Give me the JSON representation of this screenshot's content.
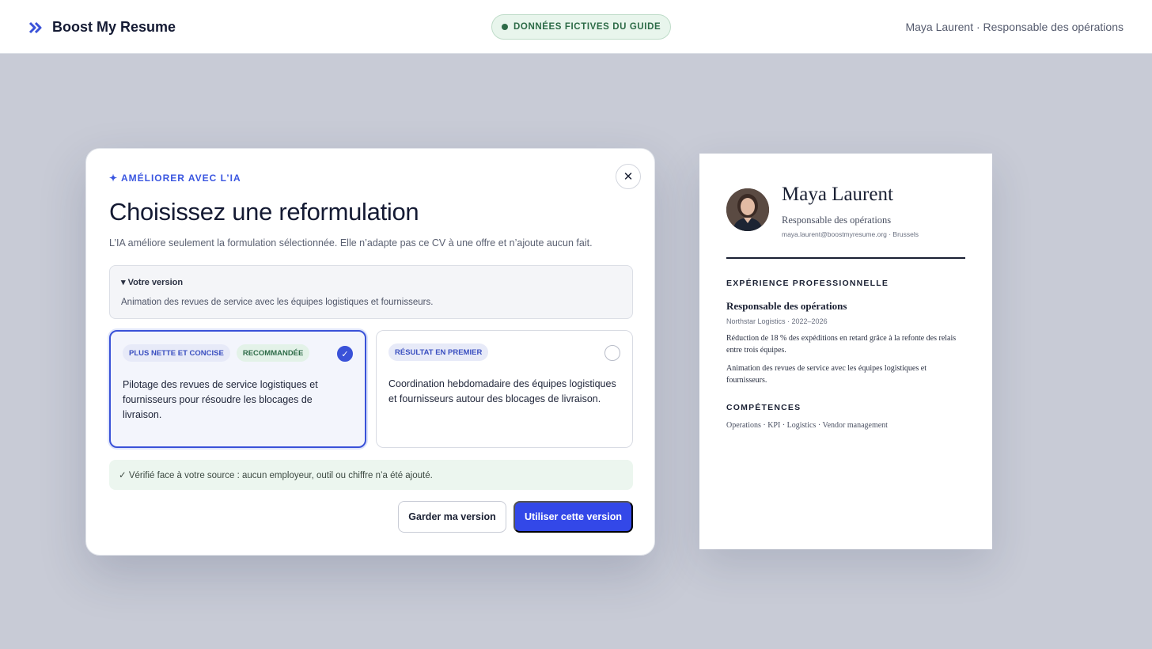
{
  "header": {
    "brand_name": "Boost My Resume",
    "brand_icon": "double-chevron-right-icon",
    "badge": "DONNÉES FICTIVES DU GUIDE",
    "user_line": "Maya Laurent · Responsable des opérations"
  },
  "modal": {
    "kicker": "✦ AMÉLIORER AVEC L’IA",
    "close_label": "✕",
    "title": "Choisissez une reformulation",
    "subtitle": "L’IA améliore seulement la formulation sélectionnée. Elle n’adapte pas ce CV à une offre et n’ajoute aucun fait.",
    "original": {
      "summary": "▾ Votre version",
      "text": "Animation des revues de service avec les équipes logistiques et fournisseurs."
    },
    "options": [
      {
        "tags": [
          "PLUS NETTE ET CONCISE",
          "RECOMMANDÉE"
        ],
        "text": "Pilotage des revues de service logistiques et fournisseurs pour résoudre les blocages de livraison.",
        "selected": true
      },
      {
        "tags": [
          "RÉSULTAT EN PREMIER"
        ],
        "text": "Coordination hebdomadaire des équipes logistiques et fournisseurs autour des blocages de livraison.",
        "selected": false
      }
    ],
    "verified": "✓ Vérifié face à votre source : aucun employeur, outil ou chiffre n’a été ajouté.",
    "buttons": {
      "keep": "Garder ma version",
      "use": "Utiliser cette version"
    }
  },
  "resume": {
    "name": "Maya Laurent",
    "role": "Responsable des opérations",
    "contact": "maya.laurent@boostmyresume.org · Brussels",
    "experience_heading": "EXPÉRIENCE PROFESSIONNELLE",
    "job_title": "Responsable des opérations",
    "job_meta": "Northstar Logistics · 2022–2026",
    "bullets": [
      "Réduction de 18 % des expéditions en retard grâce à la refonte des relais entre trois équipes.",
      "Animation des revues de service avec les équipes logistiques et fournisseurs."
    ],
    "skills_heading": "COMPÉTENCES",
    "skills": "Operations · KPI · Logistics · Vendor management"
  },
  "colors": {
    "accent": "#3348e8",
    "success_bg": "#ecf6ef",
    "success_text": "#2d6b47",
    "page_bg": "#c8cbd6"
  }
}
